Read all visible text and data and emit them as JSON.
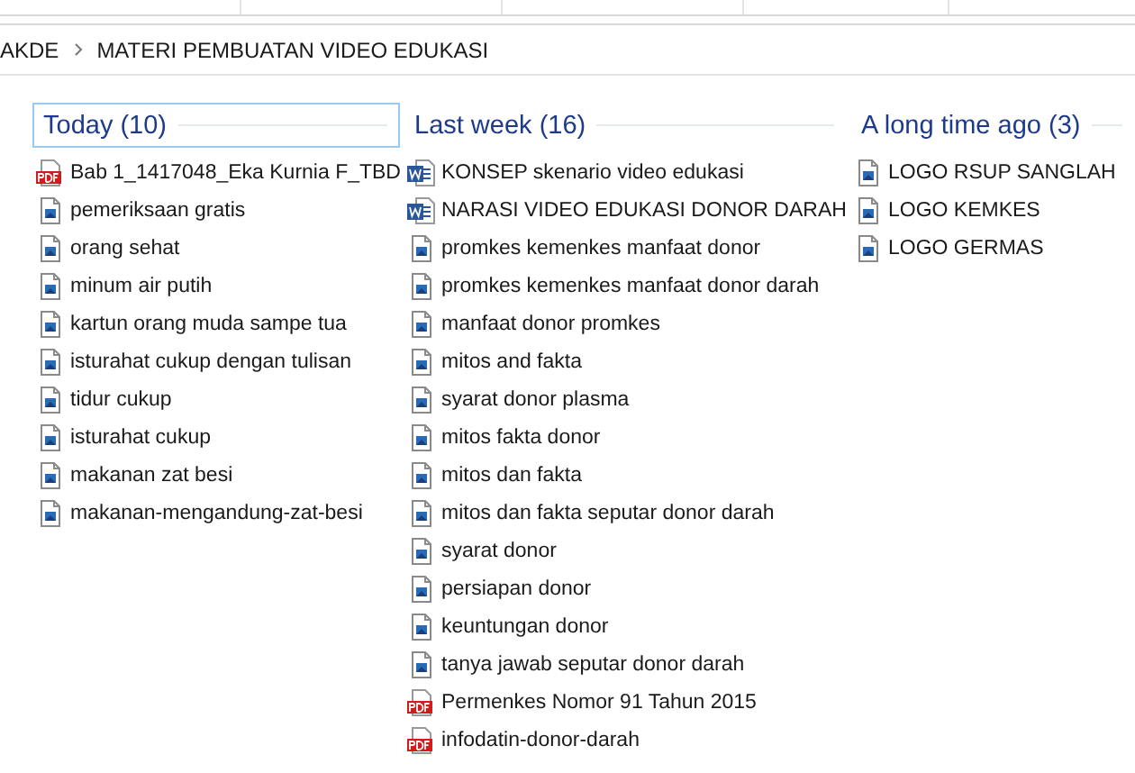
{
  "breadcrumb": [
    {
      "label": "AKDE"
    },
    {
      "label": "MATERI PEMBUATAN VIDEO EDUKASI"
    }
  ],
  "groups": [
    {
      "title": "Today (10)",
      "selected": true,
      "items": [
        {
          "name": "Bab 1_1417048_Eka Kurnia F_TBD",
          "kind": "pdf"
        },
        {
          "name": "pemeriksaan gratis",
          "kind": "image"
        },
        {
          "name": "orang sehat",
          "kind": "image"
        },
        {
          "name": "minum air putih",
          "kind": "image"
        },
        {
          "name": "kartun orang muda sampe tua",
          "kind": "image"
        },
        {
          "name": "isturahat cukup dengan tulisan",
          "kind": "image"
        },
        {
          "name": "tidur cukup",
          "kind": "image"
        },
        {
          "name": "isturahat cukup",
          "kind": "image"
        },
        {
          "name": "makanan zat besi",
          "kind": "image"
        },
        {
          "name": "makanan-mengandung-zat-besi",
          "kind": "image"
        }
      ]
    },
    {
      "title": "Last week (16)",
      "selected": false,
      "items": [
        {
          "name": "KONSEP skenario video edukasi",
          "kind": "word"
        },
        {
          "name": "NARASI VIDEO EDUKASI DONOR DARAH",
          "kind": "word"
        },
        {
          "name": "promkes kemenkes manfaat donor",
          "kind": "image"
        },
        {
          "name": "promkes kemenkes manfaat donor darah",
          "kind": "image"
        },
        {
          "name": "manfaat donor promkes",
          "kind": "image"
        },
        {
          "name": "mitos and fakta",
          "kind": "image"
        },
        {
          "name": "syarat donor plasma",
          "kind": "image"
        },
        {
          "name": "mitos fakta donor",
          "kind": "image"
        },
        {
          "name": "mitos dan fakta",
          "kind": "image"
        },
        {
          "name": "mitos dan fakta seputar donor darah",
          "kind": "image"
        },
        {
          "name": "syarat donor",
          "kind": "image"
        },
        {
          "name": "persiapan donor",
          "kind": "image"
        },
        {
          "name": "keuntungan donor",
          "kind": "image"
        },
        {
          "name": "tanya jawab seputar donor darah",
          "kind": "image"
        },
        {
          "name": "Permenkes Nomor 91 Tahun 2015",
          "kind": "pdf"
        },
        {
          "name": "infodatin-donor-darah",
          "kind": "pdf"
        }
      ]
    },
    {
      "title": "A long time ago (3)",
      "selected": false,
      "items": [
        {
          "name": "LOGO RSUP SANGLAH",
          "kind": "image"
        },
        {
          "name": "LOGO KEMKES",
          "kind": "image"
        },
        {
          "name": "LOGO GERMAS",
          "kind": "image"
        }
      ]
    }
  ]
}
